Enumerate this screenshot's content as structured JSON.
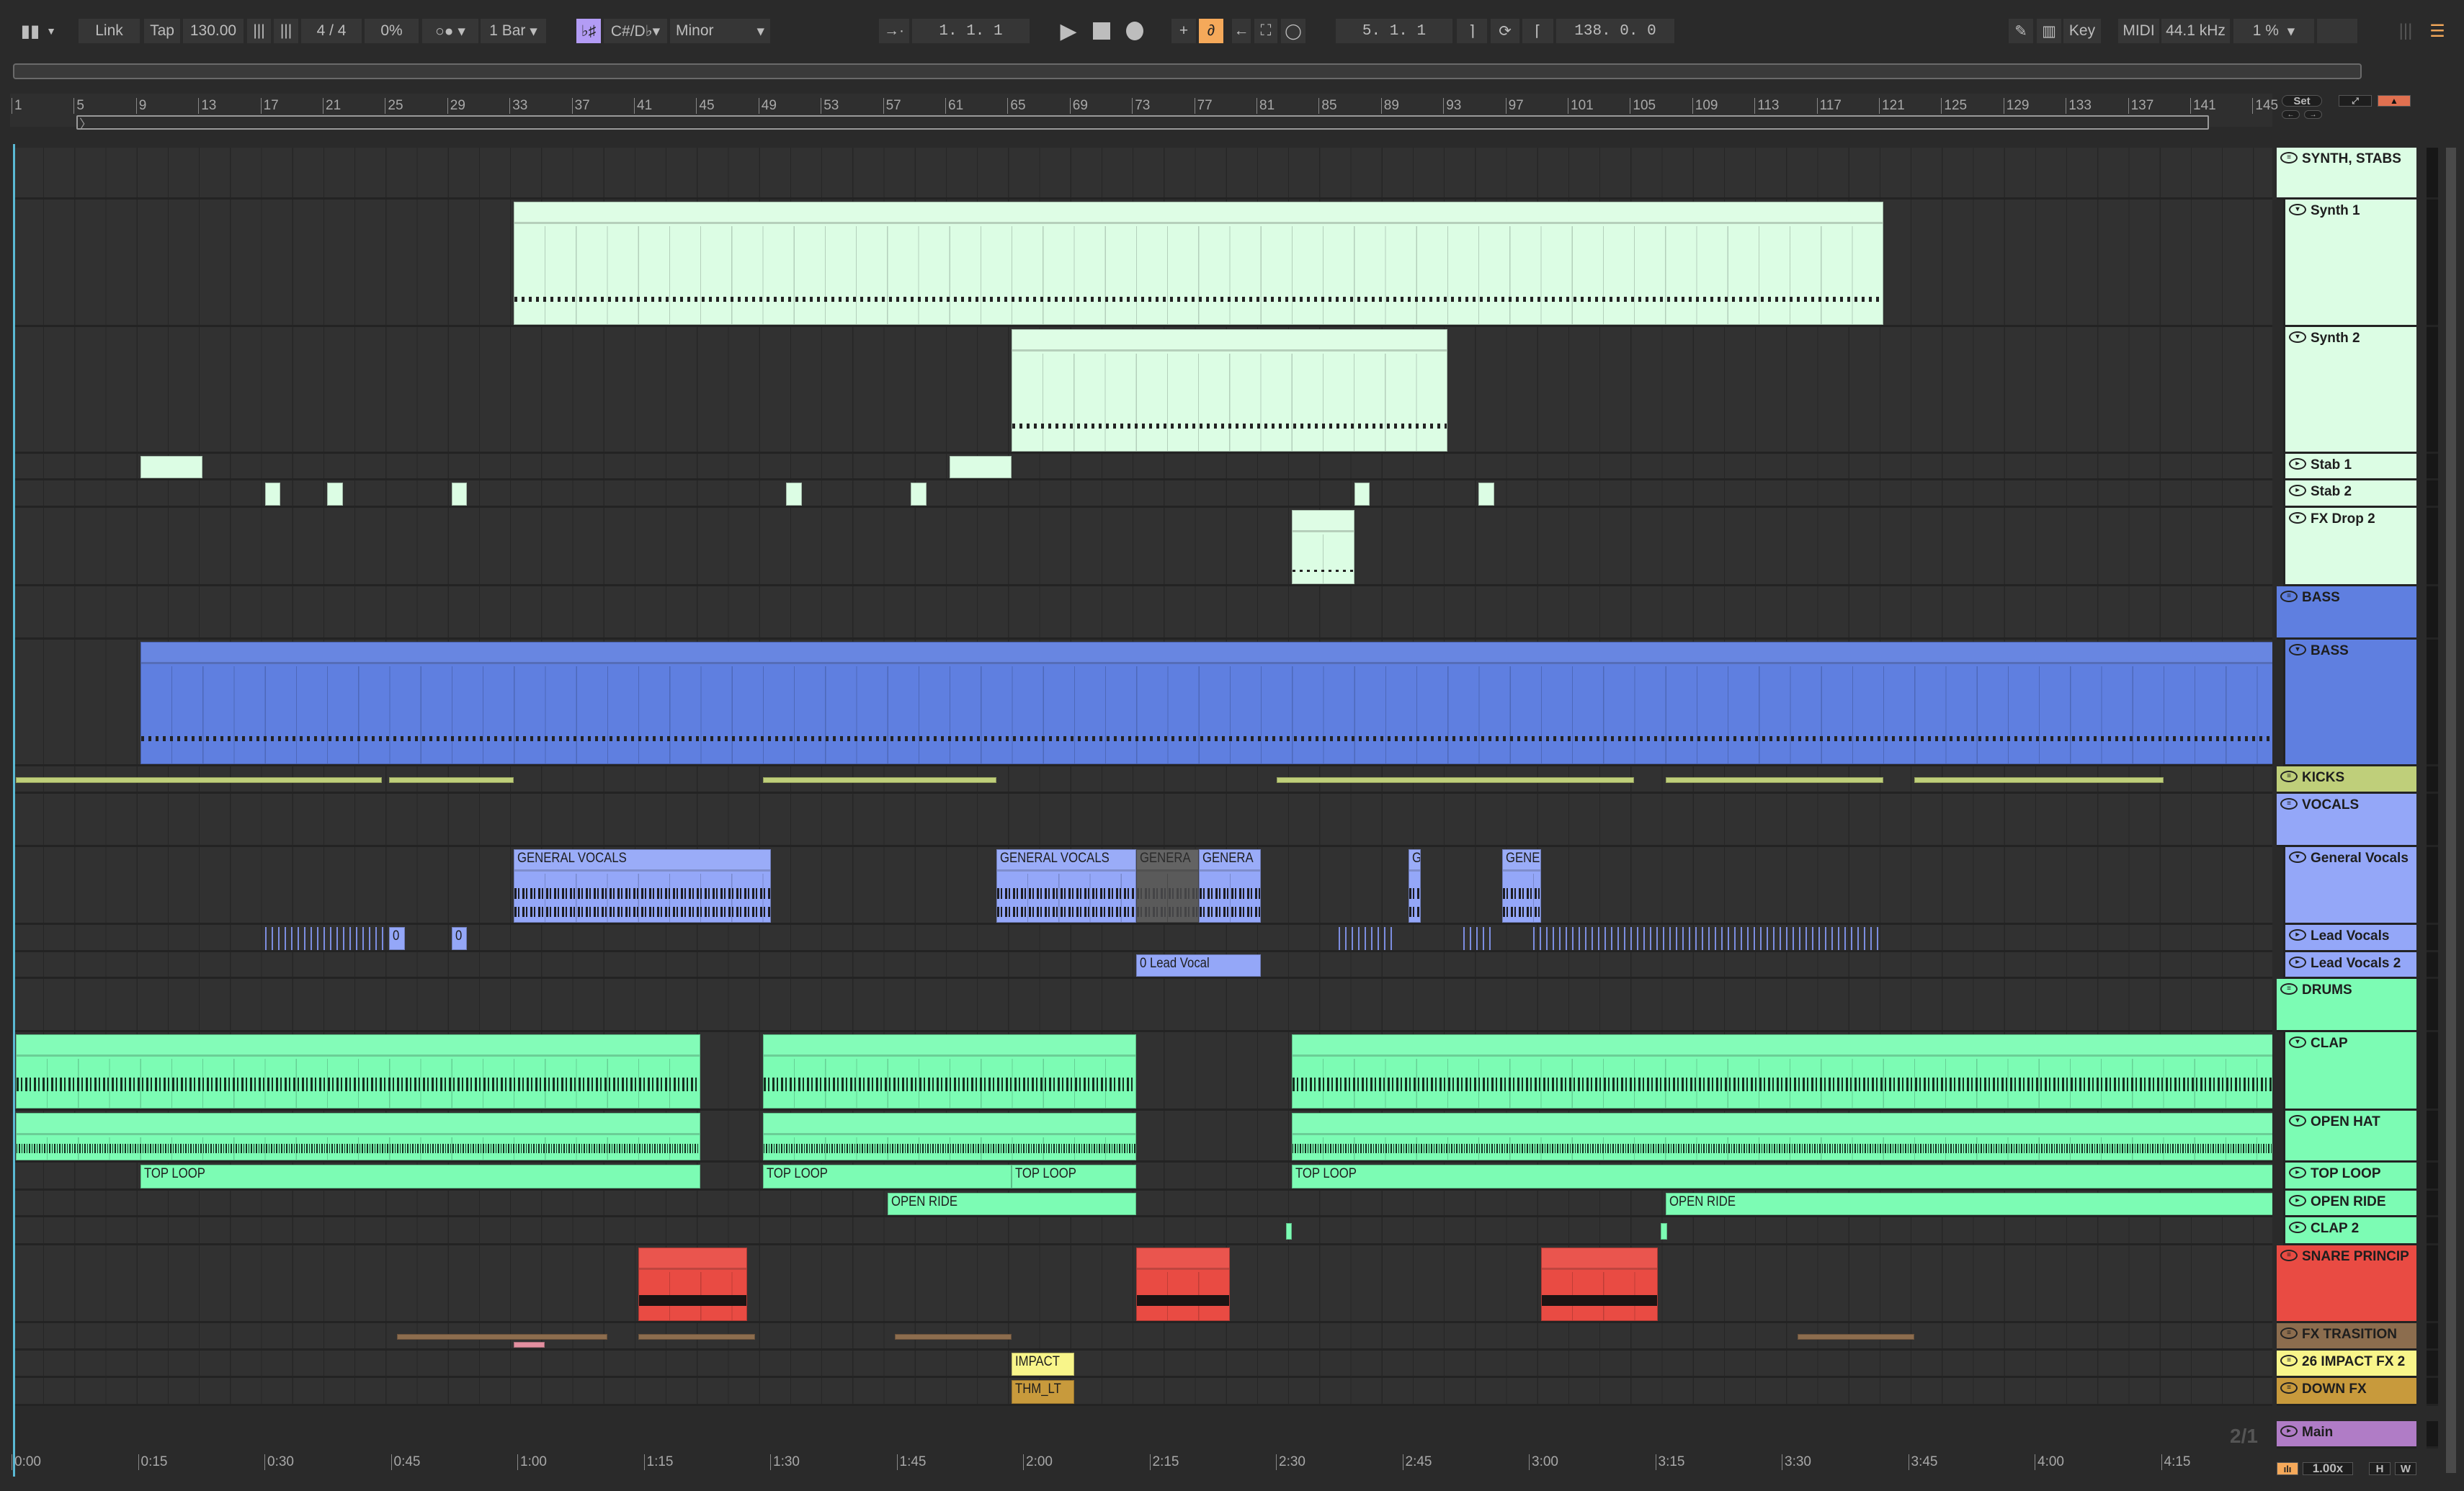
{
  "toolbar": {
    "link": "Link",
    "tap": "Tap",
    "tempo": "130.00",
    "signature": "4 / 4",
    "groove": "0%",
    "quantize": "1 Bar",
    "key_root": "C#/D♭",
    "key_scale": "Minor",
    "position": "1.  1.  1",
    "loop_start": "5.  1.  1",
    "loop_length": "138.  0.  0",
    "key": "Key",
    "midi": "MIDI",
    "sample_rate": "44.1 kHz",
    "cpu": "1 %"
  },
  "ruler": {
    "bars": [
      "1",
      "5",
      "9",
      "13",
      "17",
      "21",
      "25",
      "29",
      "33",
      "37",
      "41",
      "45",
      "49",
      "53",
      "57",
      "61",
      "65",
      "69",
      "73",
      "77",
      "81",
      "85",
      "89",
      "93",
      "97",
      "101",
      "105",
      "109",
      "113",
      "117",
      "121",
      "125",
      "129",
      "133",
      "137",
      "141",
      "145"
    ]
  },
  "timeline": {
    "labels": [
      "0:00",
      "0:15",
      "0:30",
      "0:45",
      "1:00",
      "1:15",
      "1:30",
      "1:45",
      "2:00",
      "2:15",
      "2:30",
      "2:45",
      "3:00",
      "3:15",
      "3:30",
      "3:45",
      "4:00",
      "4:15"
    ]
  },
  "side": {
    "set": "Set",
    "zoom": "1.00x",
    "h": "H",
    "w": "W",
    "page": "2/1"
  },
  "tracks": [
    {
      "name": "SYNTH, STABS",
      "type": "group",
      "color": "#dcfde4",
      "clips": []
    },
    {
      "name": "Synth 1",
      "type": "child",
      "color": "#dcfde4",
      "clips": [
        {
          "s": 33,
          "e": 121,
          "kind": "midi"
        }
      ]
    },
    {
      "name": "Synth 2",
      "type": "child",
      "color": "#dcfde4",
      "clips": [
        {
          "s": 65,
          "e": 93,
          "kind": "midi"
        }
      ]
    },
    {
      "name": "Stab 1",
      "type": "child",
      "color": "#dcfde4",
      "clips": [
        {
          "s": 9,
          "e": 13
        },
        {
          "s": 61,
          "e": 65
        }
      ]
    },
    {
      "name": "Stab 2",
      "type": "child",
      "color": "#dcfde4",
      "clips": [
        {
          "s": 17,
          "e": 18
        },
        {
          "s": 21,
          "e": 22
        },
        {
          "s": 29,
          "e": 30
        },
        {
          "s": 50.5,
          "e": 51.5
        },
        {
          "s": 58.5,
          "e": 59.5
        },
        {
          "s": 87,
          "e": 88
        },
        {
          "s": 95,
          "e": 96
        }
      ]
    },
    {
      "name": "FX Drop 2",
      "type": "child",
      "color": "#dcfde4",
      "clips": [
        {
          "s": 83,
          "e": 87,
          "kind": "midi"
        }
      ]
    },
    {
      "name": "BASS",
      "type": "group",
      "color": "#5f7fe0",
      "clips": []
    },
    {
      "name": "BASS",
      "type": "child",
      "color": "#5f7fe0",
      "clips": [
        {
          "s": 9,
          "e": 147,
          "kind": "midi"
        }
      ]
    },
    {
      "name": "KICKS",
      "type": "group",
      "color": "#bfcf7a",
      "clips": [
        {
          "s": 1,
          "e": 24.5,
          "kind": "thin"
        },
        {
          "s": 25,
          "e": 33,
          "kind": "thin"
        },
        {
          "s": 49,
          "e": 64,
          "kind": "thin"
        },
        {
          "s": 82,
          "e": 105,
          "kind": "thin"
        },
        {
          "s": 107,
          "e": 121,
          "kind": "thin"
        },
        {
          "s": 123,
          "e": 139,
          "kind": "thin"
        }
      ]
    },
    {
      "name": "VOCALS",
      "type": "group",
      "color": "#94a7f8",
      "clips": []
    },
    {
      "name": "General Vocals",
      "type": "child",
      "color": "#94a7f8",
      "clips": [
        {
          "s": 33,
          "e": 49.5,
          "kind": "audio",
          "label": "GENERAL VOCALS"
        },
        {
          "s": 64,
          "e": 73,
          "kind": "audio",
          "label": "GENERAL VOCALS"
        },
        {
          "s": 73,
          "e": 77,
          "kind": "muted",
          "label": "GENERA"
        },
        {
          "s": 77,
          "e": 81,
          "kind": "audio",
          "label": "GENERA"
        },
        {
          "s": 90.5,
          "e": 91.3,
          "kind": "audio",
          "label": "G"
        },
        {
          "s": 96.5,
          "e": 99,
          "kind": "audio",
          "label": "GENE"
        }
      ]
    },
    {
      "name": "Lead Vocals",
      "type": "child",
      "color": "#94a7f8",
      "clips": [
        {
          "s": 17,
          "e": 24.7,
          "kind": "ticks"
        },
        {
          "s": 25,
          "e": 26,
          "label": "0"
        },
        {
          "s": 29,
          "e": 30,
          "label": "0"
        },
        {
          "s": 86,
          "e": 89.5,
          "kind": "ticks"
        },
        {
          "s": 94,
          "e": 96,
          "kind": "ticks"
        },
        {
          "s": 98.5,
          "e": 121,
          "kind": "ticks"
        }
      ]
    },
    {
      "name": "Lead Vocals 2",
      "type": "child",
      "color": "#94a7f8",
      "clips": [
        {
          "s": 73,
          "e": 81,
          "label": "0 Lead Vocal"
        }
      ]
    },
    {
      "name": "DRUMS",
      "type": "group",
      "color": "#7cfcb4",
      "clips": []
    },
    {
      "name": "CLAP",
      "type": "child",
      "color": "#7cfcb4",
      "clips": [
        {
          "s": 1,
          "e": 45,
          "kind": "drum"
        },
        {
          "s": 49,
          "e": 73,
          "kind": "drum"
        },
        {
          "s": 83,
          "e": 147,
          "kind": "drum"
        }
      ]
    },
    {
      "name": "OPEN HAT",
      "type": "child",
      "color": "#7cfcb4",
      "clips": [
        {
          "s": 1,
          "e": 45,
          "kind": "drum2"
        },
        {
          "s": 49,
          "e": 73,
          "kind": "drum2"
        },
        {
          "s": 83,
          "e": 147,
          "kind": "drum2"
        }
      ]
    },
    {
      "name": "TOP LOOP",
      "type": "child",
      "color": "#7cfcb4",
      "clips": [
        {
          "s": 9,
          "e": 45,
          "label": "TOP LOOP"
        },
        {
          "s": 49,
          "e": 65,
          "label": "TOP LOOP"
        },
        {
          "s": 65,
          "e": 73,
          "label": "TOP LOOP"
        },
        {
          "s": 83,
          "e": 147,
          "label": "TOP LOOP"
        }
      ]
    },
    {
      "name": "OPEN RIDE",
      "type": "child",
      "color": "#7cfcb4",
      "clips": [
        {
          "s": 57,
          "e": 73,
          "label": "OPEN RIDE"
        },
        {
          "s": 107,
          "e": 147,
          "label": "OPEN RIDE"
        }
      ]
    },
    {
      "name": "CLAP 2",
      "type": "child",
      "color": "#7cfcb4",
      "clips": [
        {
          "s": 82.6,
          "e": 83,
          "kind": "tiny"
        },
        {
          "s": 106.7,
          "e": 107.1,
          "kind": "tiny"
        }
      ]
    },
    {
      "name": "SNARE PRINCIP",
      "type": "group",
      "color": "#e94b43",
      "clips": [
        {
          "s": 41,
          "e": 48,
          "kind": "snare"
        },
        {
          "s": 73,
          "e": 79,
          "kind": "snare"
        },
        {
          "s": 99,
          "e": 106.5,
          "kind": "snare"
        }
      ]
    },
    {
      "name": "FX TRASITION",
      "type": "group",
      "color": "#8c6d4e",
      "clips": [
        {
          "s": 25.5,
          "e": 39,
          "kind": "thin"
        },
        {
          "s": 41,
          "e": 48.5,
          "kind": "thin"
        },
        {
          "s": 57.5,
          "e": 65,
          "kind": "thin"
        },
        {
          "s": 115.5,
          "e": 123,
          "kind": "thin"
        }
      ]
    },
    {
      "name": "26 IMPACT FX 2",
      "type": "group",
      "color": "#f8f58a",
      "clips": [
        {
          "s": 65,
          "e": 69,
          "label": "IMPACT"
        }
      ]
    },
    {
      "name": "DOWN FX",
      "type": "group",
      "color": "#c89a3c",
      "clips": [
        {
          "s": 65,
          "e": 69,
          "label": "THM_LT"
        }
      ]
    },
    {
      "name": "Main",
      "type": "main",
      "color": "#b07cc6",
      "clips": []
    }
  ]
}
